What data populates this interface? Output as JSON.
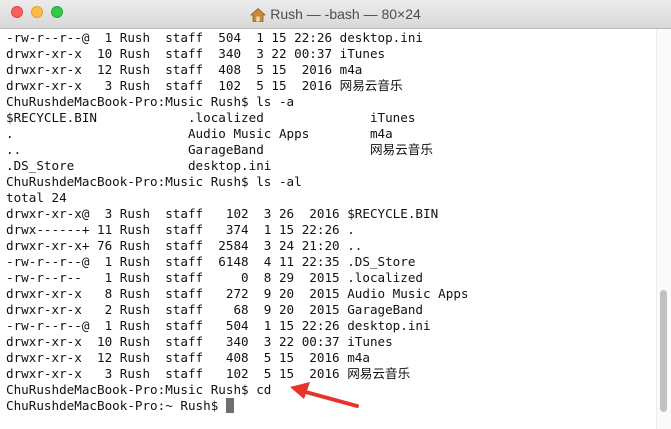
{
  "window": {
    "title": "Rush — -bash — 80×24",
    "icon": "home-folder-icon"
  },
  "terminal": {
    "lines": [
      "-rw-r--r--@  1 Rush  staff  504  1 15 22:26 desktop.ini",
      "drwxr-xr-x  10 Rush  staff  340  3 22 00:37 iTunes",
      "drwxr-xr-x  12 Rush  staff  408  5 15  2016 m4a",
      "drwxr-xr-x   3 Rush  staff  102  5 15  2016 网易云音乐",
      "ChuRushdeMacBook-Pro:Music Rush$ ls -a",
      "$RECYCLE.BIN            .localized              iTunes",
      ".                       Audio Music Apps        m4a",
      "..                      GarageBand              网易云音乐",
      ".DS_Store               desktop.ini",
      "ChuRushdeMacBook-Pro:Music Rush$ ls -al",
      "total 24",
      "drwxr-xr-x@  3 Rush  staff   102  3 26  2016 $RECYCLE.BIN",
      "drwx------+ 11 Rush  staff   374  1 15 22:26 .",
      "drwxr-xr-x+ 76 Rush  staff  2584  3 24 21:20 ..",
      "-rw-r--r--@  1 Rush  staff  6148  4 11 22:35 .DS_Store",
      "-rw-r--r--   1 Rush  staff     0  8 29  2015 .localized",
      "drwxr-xr-x   8 Rush  staff   272  9 20  2015 Audio Music Apps",
      "drwxr-xr-x   2 Rush  staff    68  9 20  2015 GarageBand",
      "-rw-r--r--@  1 Rush  staff   504  1 15 22:26 desktop.ini",
      "drwxr-xr-x  10 Rush  staff   340  3 22 00:37 iTunes",
      "drwxr-xr-x  12 Rush  staff   408  5 15  2016 m4a",
      "drwxr-xr-x   3 Rush  staff   102  5 15  2016 网易云音乐",
      "ChuRushdeMacBook-Pro:Music Rush$ cd",
      "ChuRushdeMacBook-Pro:~ Rush$ "
    ]
  },
  "annotation": {
    "color": "#e8332a"
  }
}
